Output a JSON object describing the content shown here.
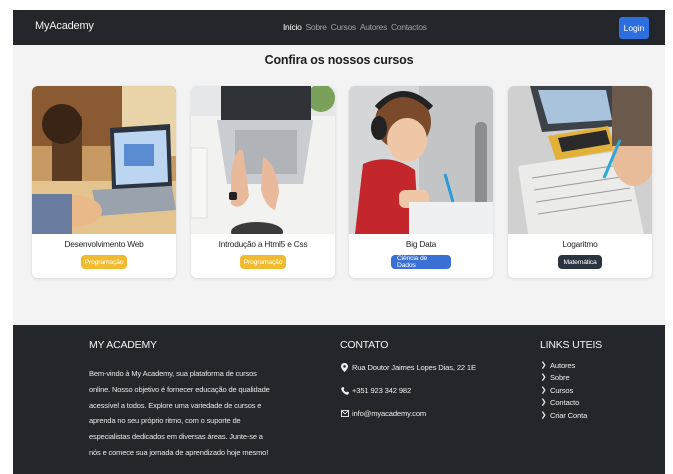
{
  "navbar": {
    "brand": "MyAcademy",
    "links": [
      "Início",
      "Sobre",
      "Cursos",
      "Autores",
      "Contactos"
    ],
    "login_label": "Login"
  },
  "section_title": "Confira os nossos cursos",
  "courses": [
    {
      "title": "Desenvolvimento Web",
      "badge": "Programação",
      "badge_color": "#f0bb30"
    },
    {
      "title": "Introdução a Html5 e Css",
      "badge": "Programação",
      "badge_color": "#f0bb30"
    },
    {
      "title": "Big Data",
      "badge": "Ciência de Dados",
      "badge_color": "#3a70d5"
    },
    {
      "title": "Logaritmo",
      "badge": "Matemática",
      "badge_color": "#2a3340"
    }
  ],
  "footer": {
    "about": {
      "heading": "MY ACADEMY",
      "text": "Bem-vindo à My Academy, sua plataforma de cursos online. Nosso objetivo é fornecer educação de qualidade acessível a todos. Explore uma variedade de cursos e aprenda no seu próprio ritmo, com o suporte de especialistas dedicados em diversas áreas. Junte-se a nós e comece sua jornada de aprendizado hoje mesmo!"
    },
    "contact": {
      "heading": "CONTATO",
      "address": "Rua Doutor Jaimes Lopes Dias, 22 1E",
      "phone": "+351 923 342 982",
      "email": "info@myacademy.com"
    },
    "links": {
      "heading": "LINKS UTEIS",
      "items": [
        "Autores",
        "Sobre",
        "Cursos",
        "Contacto",
        "Criar Conta"
      ]
    }
  }
}
